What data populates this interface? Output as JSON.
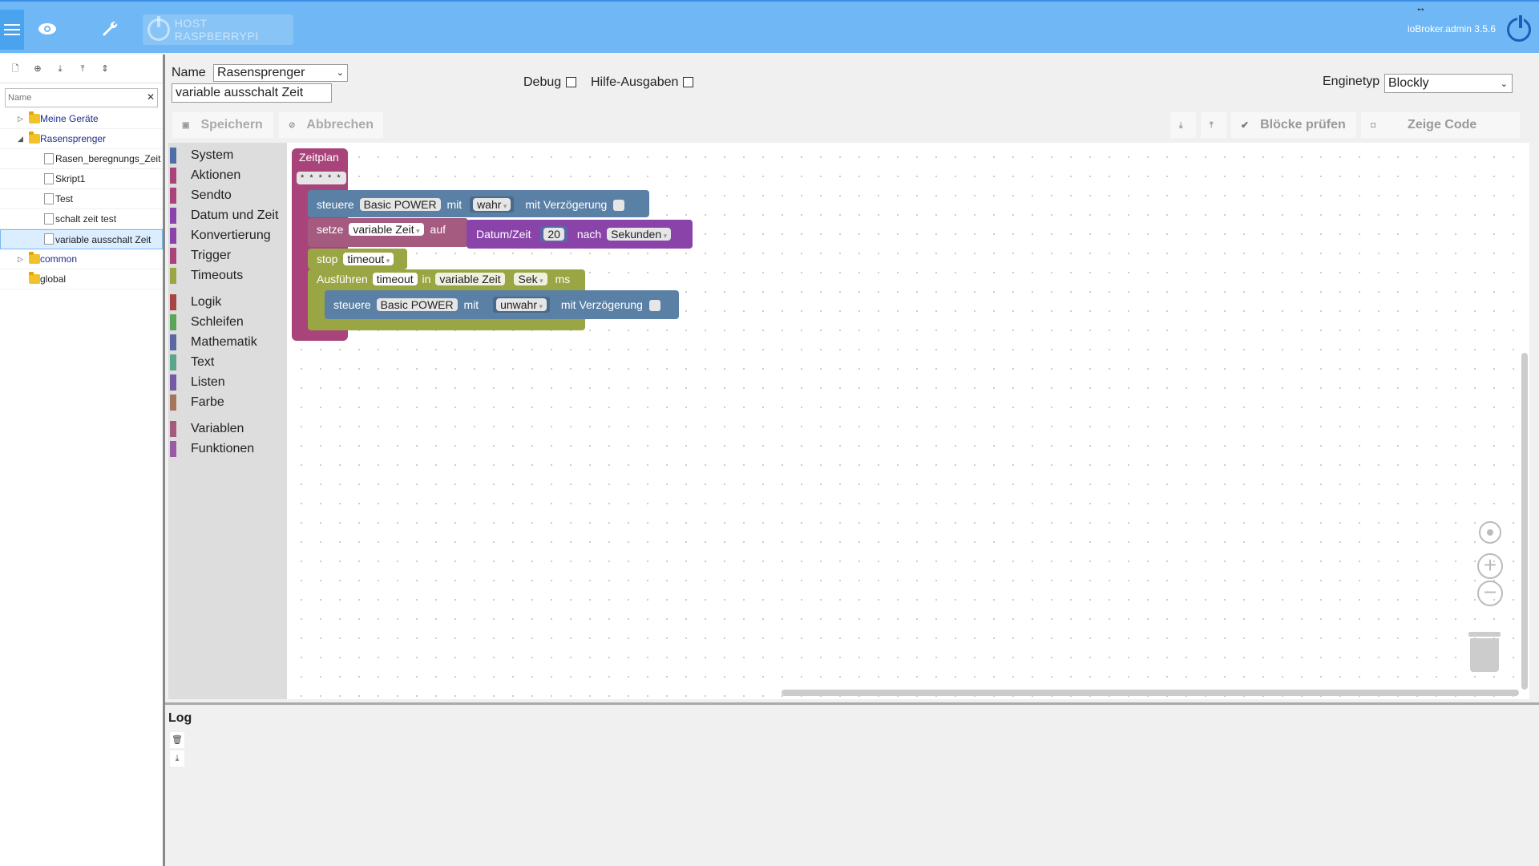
{
  "topbar": {
    "host_label": "HOST RASPBERRYPI",
    "version": "ioBroker.admin 3.5.6"
  },
  "tree": {
    "filter_placeholder": "Name",
    "items": [
      {
        "label": "Meine Geräte",
        "type": "folder",
        "level": 0,
        "expanded": false
      },
      {
        "label": "Rasensprenger",
        "type": "folder",
        "level": 0,
        "expanded": true
      },
      {
        "label": "Rasen_beregnungs_Zeit",
        "type": "file",
        "level": 1
      },
      {
        "label": "Skript1",
        "type": "file",
        "level": 1
      },
      {
        "label": "Test",
        "type": "file",
        "level": 1
      },
      {
        "label": "schalt zeit test",
        "type": "file",
        "level": 1
      },
      {
        "label": "variable ausschalt Zeit",
        "type": "file",
        "level": 1,
        "selected": true
      },
      {
        "label": "common",
        "type": "folder",
        "level": 0,
        "expanded": false
      },
      {
        "label": "global",
        "type": "folder",
        "level": 0,
        "expanded": null
      }
    ]
  },
  "editor": {
    "name_label": "Name",
    "name_value": "Rasensprenger",
    "script_name": "variable ausschalt Zeit",
    "debug_label": "Debug",
    "help_label": "Hilfe-Ausgaben",
    "engine_label": "Enginetyp",
    "engine_value": "Blockly",
    "save_label": "Speichern",
    "cancel_label": "Abbrechen",
    "check_label": "Blöcke prüfen",
    "code_label": "Zeige Code"
  },
  "toolbox": {
    "categories": [
      {
        "label": "System",
        "color": "#4c6fa8"
      },
      {
        "label": "Aktionen",
        "color": "#a9447a"
      },
      {
        "label": "Sendto",
        "color": "#a9447a"
      },
      {
        "label": "Datum und Zeit",
        "color": "#8a44a9"
      },
      {
        "label": "Konvertierung",
        "color": "#8a44a9"
      },
      {
        "label": "Trigger",
        "color": "#a9447a"
      },
      {
        "label": "Timeouts",
        "color": "#9aa644"
      },
      {
        "label": "Logik",
        "color": "#a94444"
      },
      {
        "label": "Schleifen",
        "color": "#5ba55b"
      },
      {
        "label": "Mathematik",
        "color": "#5b67a5"
      },
      {
        "label": "Text",
        "color": "#5ba58c"
      },
      {
        "label": "Listen",
        "color": "#745ba5"
      },
      {
        "label": "Farbe",
        "color": "#a5745b"
      },
      {
        "label": "Variablen",
        "color": "#a55b80"
      },
      {
        "label": "Funktionen",
        "color": "#9a5ba5"
      }
    ]
  },
  "blocks": {
    "schedule": {
      "label": "Zeitplan",
      "cron": "* * * * *",
      "color": "#a9447a"
    },
    "control1": {
      "label": "steuere",
      "device": "Basic POWER",
      "with": "mit",
      "value": "wahr",
      "delay_label": "mit Verzögerung",
      "color": "#5b80a5"
    },
    "setvar": {
      "label": "setze",
      "var": "variable Zeit",
      "to": "auf",
      "color": "#a55b80"
    },
    "datetime": {
      "label": "Datum/Zeit",
      "value": "20",
      "after": "nach",
      "unit": "Sekunden",
      "color": "#8a44a9"
    },
    "stop": {
      "label": "stop",
      "name": "timeout",
      "color": "#9aa644"
    },
    "run": {
      "label": "Ausführen",
      "name": "timeout",
      "in": "in",
      "var": "variable Zeit",
      "unit": "Sek",
      "ms": "ms",
      "color": "#9aa644"
    },
    "control2": {
      "label": "steuere",
      "device": "Basic POWER",
      "with": "mit",
      "value": "unwahr",
      "delay_label": "mit Verzögerung",
      "color": "#5b80a5"
    }
  },
  "log": {
    "title": "Log"
  }
}
